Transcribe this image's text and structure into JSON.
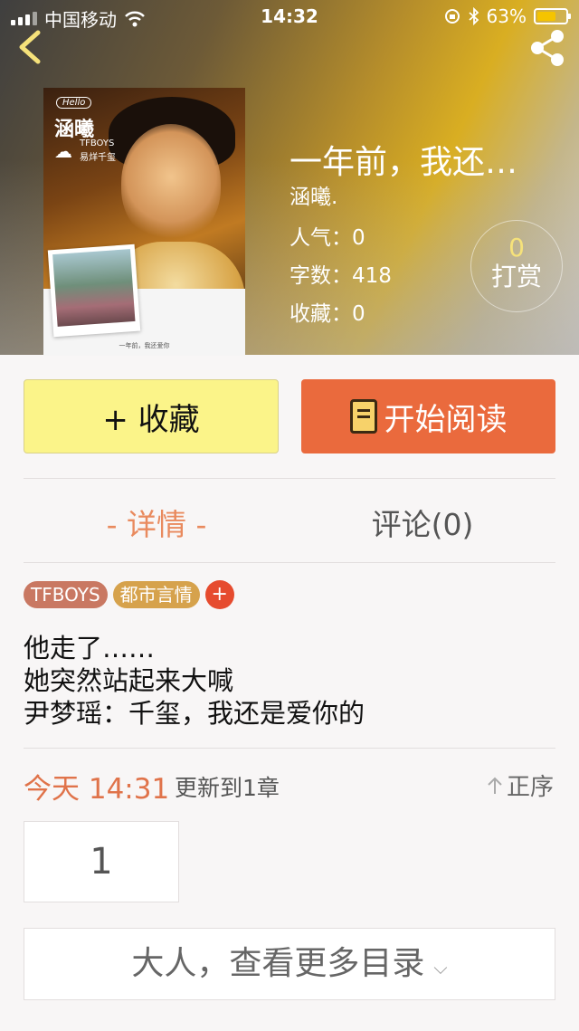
{
  "status_bar": {
    "carrier": "中国移动",
    "time": "14:32",
    "battery": "63%"
  },
  "book": {
    "title": "一年前，我还…",
    "author": "涵曦.",
    "popularity_label": "人气：",
    "popularity": "0",
    "words_label": "字数：",
    "words": "418",
    "favorites_label": "收藏：",
    "favorites": "0",
    "reward_count": "0",
    "reward_label": "打赏"
  },
  "cover": {
    "hello": "Hello",
    "name": "涵曦",
    "weather_icon": "☁",
    "tag1": "TFBOYS",
    "tag2": "易烊千玺",
    "footer": "一年前，我还爱你"
  },
  "actions": {
    "favorite": "+ 收藏",
    "start_reading": "开始阅读"
  },
  "tabs": {
    "detail": "- 详情 -",
    "comments": "评论(0)"
  },
  "tags": [
    {
      "label": "TFBOYS",
      "color": "#c97862"
    },
    {
      "label": "都市言情",
      "color": "#d6a24c"
    }
  ],
  "tag_add": "+",
  "description": [
    "他走了……",
    "她突然站起来大喊",
    "尹梦瑶：千玺，我还是爱你的"
  ],
  "update": {
    "time": "今天 14:31",
    "text": "更新到1章",
    "order": "正序"
  },
  "chapter_number": "1",
  "more_catalog": "大人，查看更多目录",
  "colors": {
    "accent_orange": "#ea6a3d",
    "favorite_yellow": "#fbf489",
    "detail_tab": "#e98a5e"
  }
}
